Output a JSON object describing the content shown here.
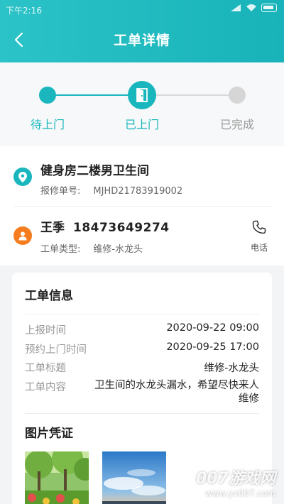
{
  "status_bar": {
    "time": "下午2:16"
  },
  "header": {
    "title": "工单详情"
  },
  "progress": {
    "steps": [
      {
        "label": "待上门",
        "state": "done"
      },
      {
        "label": "已上门",
        "state": "current"
      },
      {
        "label": "已完成",
        "state": "pending"
      }
    ]
  },
  "location": {
    "title": "健身房二楼男卫生间",
    "order_no_label": "报修单号:",
    "order_no": "MJHD21783919002"
  },
  "contact": {
    "name": "王季",
    "phone": "18473649274",
    "type_label": "工单类型:",
    "type_value": "维修-水龙头",
    "call_label": "电话"
  },
  "order_info": {
    "title": "工单信息",
    "rows": [
      {
        "label": "上报时间",
        "value": "2020-09-22 09:00"
      },
      {
        "label": "预约上门时间",
        "value": "2020-09-25 17:00"
      },
      {
        "label": "工单标题",
        "value": "维修-水龙头"
      },
      {
        "label": "工单内容",
        "value": "卫生间的水龙头漏水，希望尽快来人维修"
      }
    ],
    "photos_title": "图片凭证"
  },
  "watermark": {
    "line1": "007游戏网",
    "line2": "www.yx007.com"
  },
  "colors": {
    "accent": "#19b7bd",
    "location_icon": "#19b7bd",
    "person_icon": "#f57c1f"
  }
}
